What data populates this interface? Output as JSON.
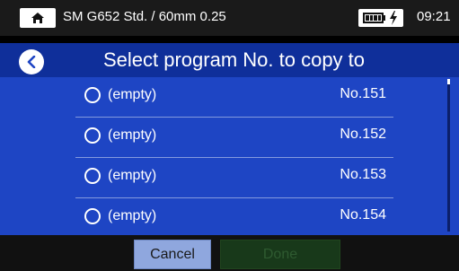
{
  "status_bar": {
    "home_icon": "home-icon",
    "title": "SM G652 Std. / 60mm 0.25",
    "battery_icon": "battery-charging-icon",
    "time": "09:21"
  },
  "header": {
    "back_icon": "chevron-left-icon",
    "title": "Select program No. to copy to"
  },
  "list": {
    "items": [
      {
        "label": "(empty)",
        "number": "No.151",
        "selected": false
      },
      {
        "label": "(empty)",
        "number": "No.152",
        "selected": false
      },
      {
        "label": "(empty)",
        "number": "No.153",
        "selected": false
      },
      {
        "label": "(empty)",
        "number": "No.154",
        "selected": false
      }
    ]
  },
  "footer": {
    "cancel_label": "Cancel",
    "done_label": "Done",
    "done_enabled": false
  },
  "colors": {
    "header_bg": "#0f2f9a",
    "list_bg": "#1e45c4",
    "cancel_bg": "#8fa7de",
    "done_bg_disabled": "#18391a"
  }
}
